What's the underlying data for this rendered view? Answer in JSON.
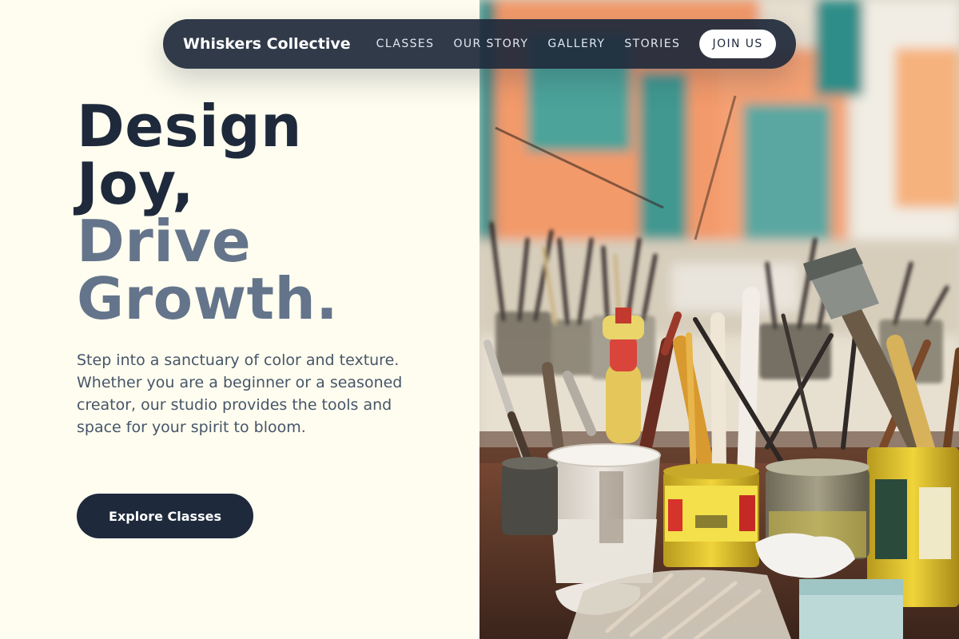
{
  "nav": {
    "brand": "Whiskers Collective",
    "links": [
      {
        "label": "CLASSES"
      },
      {
        "label": "OUR STORY"
      },
      {
        "label": "GALLERY"
      },
      {
        "label": "STORIES"
      }
    ],
    "join_label": "JOIN US"
  },
  "hero": {
    "headline": {
      "line1": "Design",
      "line2": "Joy,",
      "line3": "Drive",
      "line4": "Growth."
    },
    "subcopy": "Step into a sanctuary of color and texture. Whether you are a beginner or a seasoned creator, our studio provides the tools and space for your spirit to bloom.",
    "cta_label": "Explore Classes"
  },
  "image": {
    "subject": "art-studio-paintbrushes-photo"
  },
  "colors": {
    "background": "#fefdef",
    "primary": "#1e293b",
    "headline_muted": "#64748b",
    "body_text": "#475569"
  }
}
